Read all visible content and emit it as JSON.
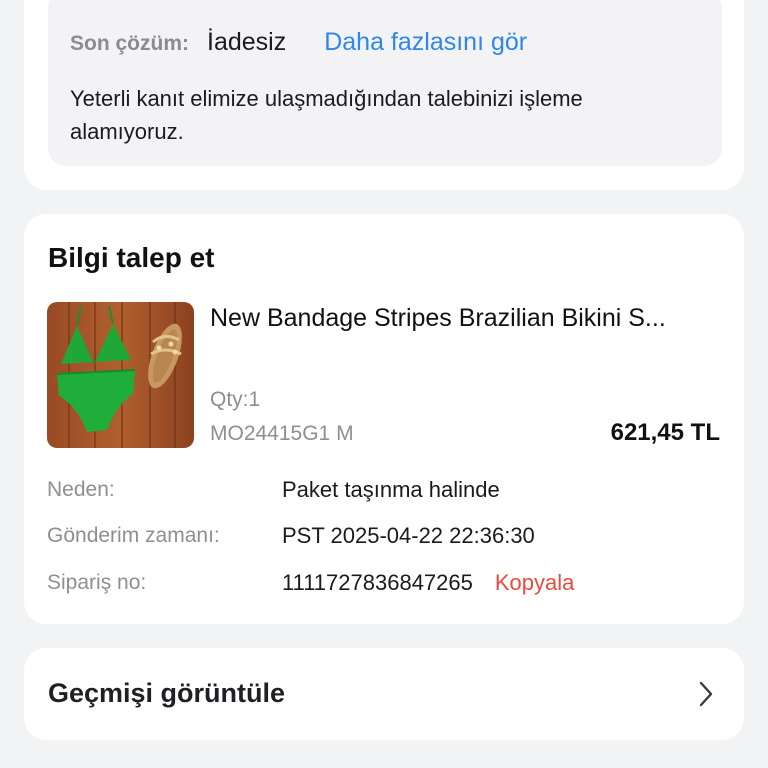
{
  "resolution": {
    "label": "Son çözüm:",
    "value": "İadesiz",
    "more_link": "Daha fazlasını gör",
    "message": "Yeterli kanıt elimize ulaşmadığından talebinizi işleme alamıyoruz."
  },
  "info": {
    "title": "Bilgi talep et",
    "product": {
      "title": "New Bandage Stripes Brazilian Bikini S...",
      "qty": "Qty:1",
      "sku": "MO24415G1 M",
      "price": "621,45 TL"
    },
    "details": [
      {
        "label": "Neden:",
        "value": "Paket taşınma halinde"
      },
      {
        "label": "Gönderim zamanı:",
        "value": "PST 2025-04-22 22:36:30"
      },
      {
        "label": "Sipariş no:",
        "value": "1111727836847265"
      }
    ],
    "copy_label": "Kopyala"
  },
  "history": {
    "label": "Geçmişi görüntüle",
    "icon": "chevron-right-icon"
  },
  "colors": {
    "link_blue": "#2f87e8",
    "copy_red": "#ea4b3a",
    "background": "#f2f3f5"
  }
}
